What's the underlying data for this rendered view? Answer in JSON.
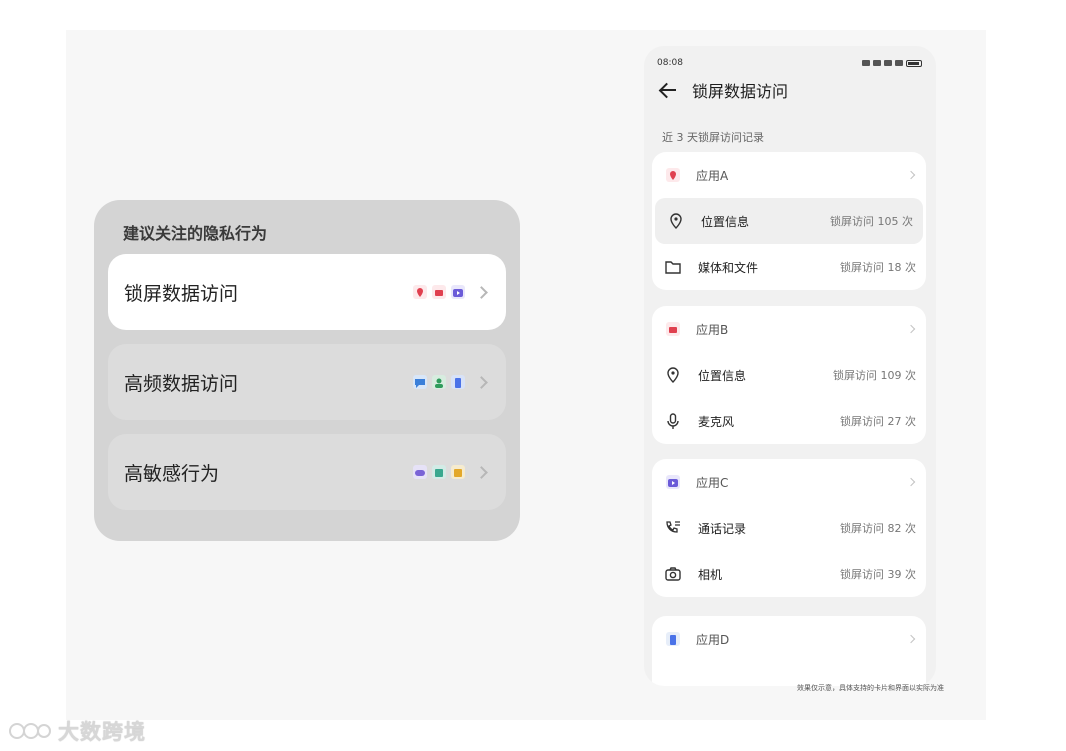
{
  "privacy_card": {
    "title": "建议关注的隐私行为",
    "rows": [
      {
        "label": "锁屏数据访问",
        "icons": [
          "location-pin-icon",
          "shop-icon",
          "video-icon"
        ]
      },
      {
        "label": "高频数据访问",
        "icons": [
          "chat-icon",
          "contact-icon",
          "phone-icon"
        ]
      },
      {
        "label": "高敏感行为",
        "icons": [
          "game-icon",
          "book-icon",
          "note-icon"
        ]
      }
    ]
  },
  "phone": {
    "time": "08:08",
    "title": "锁屏数据访问",
    "subtitle": "近 3 天锁屏访问记录",
    "apps": [
      {
        "name": "应用A",
        "badge_color": "#e8eef9",
        "perms": [
          {
            "name": "位置信息",
            "count": "锁屏访问 105 次",
            "icon": "location-icon"
          },
          {
            "name": "媒体和文件",
            "count": "锁屏访问 18 次",
            "icon": "folder-icon"
          }
        ]
      },
      {
        "name": "应用B",
        "badge_color": "#fbe7ea",
        "perms": [
          {
            "name": "位置信息",
            "count": "锁屏访问 109 次",
            "icon": "location-icon"
          },
          {
            "name": "麦克风",
            "count": "锁屏访问 27 次",
            "icon": "microphone-icon"
          }
        ]
      },
      {
        "name": "应用C",
        "badge_color": "#eceaf9",
        "perms": [
          {
            "name": "通话记录",
            "count": "锁屏访问 82 次",
            "icon": "call-log-icon"
          },
          {
            "name": "相机",
            "count": "锁屏访问 39 次",
            "icon": "camera-icon"
          }
        ]
      },
      {
        "name": "应用D",
        "badge_color": "#e7eef9",
        "perms": []
      }
    ]
  },
  "footnote": "效果仅示意，具体支持的卡片和界面以实际为准",
  "watermark": "大数跨境",
  "colors": {
    "accent_red": "#e0404f",
    "accent_blue": "#4a72e8",
    "accent_purple": "#6b5bd8"
  }
}
